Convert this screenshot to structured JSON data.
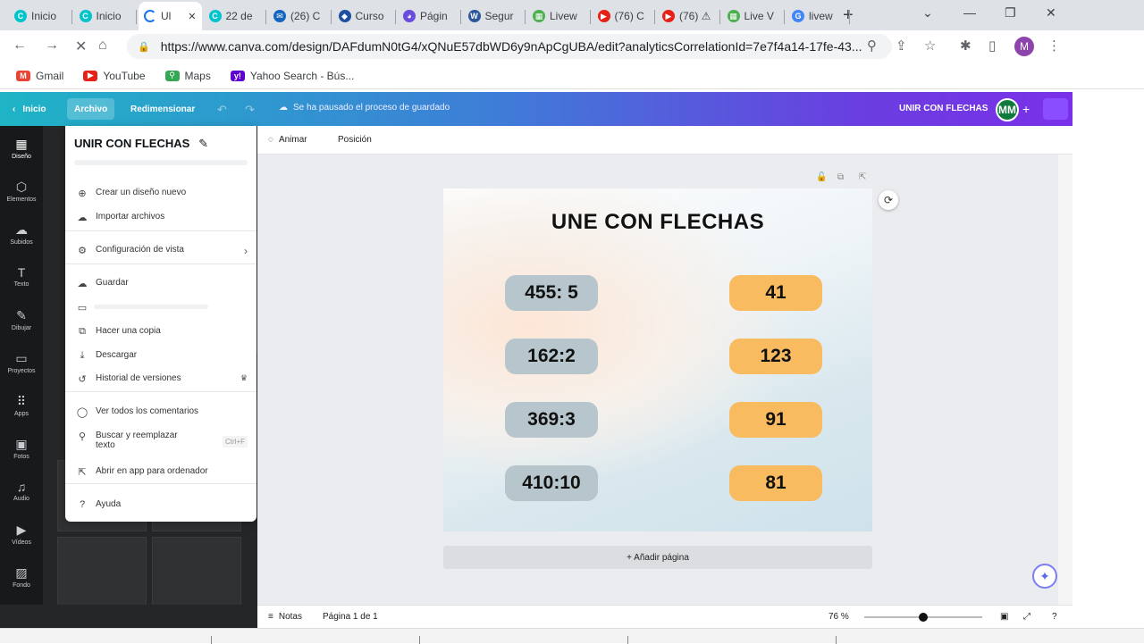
{
  "browser": {
    "tabs": [
      {
        "label": "Inicio",
        "color": "#00c4cc",
        "glyph": "C"
      },
      {
        "label": "Inicio",
        "color": "#00c4cc",
        "glyph": "C"
      },
      {
        "label": "Ul",
        "color": "#1a73e8",
        "glyph": "",
        "active": true
      },
      {
        "label": "22 de",
        "color": "#00c4cc",
        "glyph": "C"
      },
      {
        "label": "(26) C",
        "color": "#1565c0",
        "glyph": "✉"
      },
      {
        "label": "Curso",
        "color": "#1e4fa0",
        "glyph": "◆"
      },
      {
        "label": "Págin",
        "color": "#6a4cdf",
        "glyph": "◕"
      },
      {
        "label": "Segur",
        "color": "#2b579a",
        "glyph": "W"
      },
      {
        "label": "Livew",
        "color": "#4caf50",
        "glyph": "▦"
      },
      {
        "label": "(76) C",
        "color": "#e62117",
        "glyph": "▶"
      },
      {
        "label": "(76) ⚠",
        "color": "#e62117",
        "glyph": "▶"
      },
      {
        "label": "Live V",
        "color": "#4caf50",
        "glyph": "▦"
      },
      {
        "label": "livew",
        "color": "#4285f4",
        "glyph": "G"
      }
    ],
    "url": "https://www.canva.com/design/DAFdumN0tG4/xQNuE57dbWD6y9nApCgUBA/edit?analyticsCorrelationId=7e7f4a14-17fe-43...",
    "profile_initial": "M",
    "bookmarks": [
      {
        "label": "Gmail",
        "color": "#ea4335",
        "glyph": "M"
      },
      {
        "label": "YouTube",
        "color": "#e62117",
        "glyph": "▶"
      },
      {
        "label": "Maps",
        "color": "#34a853",
        "glyph": "⚲"
      },
      {
        "label": "Yahoo Search - Bús...",
        "color": "#5f01d1",
        "glyph": "y!"
      }
    ]
  },
  "canva_header": {
    "home": "Inicio",
    "file": "Archivo",
    "resize": "Redimensionar",
    "status": "Se ha pausado el proceso de guardado",
    "design_title": "UNIR CON FLECHAS",
    "user_initials": "MM"
  },
  "rail": [
    {
      "label": "Diseño",
      "icon": "▦",
      "active": true
    },
    {
      "label": "Elementos",
      "icon": "⬡"
    },
    {
      "label": "Subidos",
      "icon": "☁"
    },
    {
      "label": "Texto",
      "icon": "T"
    },
    {
      "label": "Dibujar",
      "icon": "✎"
    },
    {
      "label": "Proyectos",
      "icon": "▭"
    },
    {
      "label": "Apps",
      "icon": "⠿"
    },
    {
      "label": "Fotos",
      "icon": "▣"
    },
    {
      "label": "Audio",
      "icon": "♫"
    },
    {
      "label": "Vídeos",
      "icon": "▶"
    },
    {
      "label": "Fondo",
      "icon": "▨"
    }
  ],
  "file_menu": {
    "title": "UNIR CON FLECHAS",
    "items": [
      {
        "label": "Crear un diseño nuevo",
        "icon": "⊕"
      },
      {
        "label": "Importar archivos",
        "icon": "☁"
      },
      {
        "label": "Configuración de vista",
        "icon": "⚙",
        "arrow": "›"
      },
      {
        "label": "Guardar",
        "icon": "☁"
      },
      {
        "label": "",
        "icon": "▭"
      },
      {
        "label": "Hacer una copia",
        "icon": "⧉"
      },
      {
        "label": "Descargar",
        "icon": "⤓"
      },
      {
        "label": "Historial de versiones",
        "icon": "↺",
        "badge": "♛"
      },
      {
        "label": "Ver todos los comentarios",
        "icon": "◯"
      },
      {
        "label": "Buscar y reemplazar texto",
        "icon": "⚲",
        "shortcut": "Ctrl+F"
      },
      {
        "label": "Abrir en app para ordenador",
        "icon": "⇱"
      },
      {
        "label": "Ayuda",
        "icon": "?"
      }
    ]
  },
  "toolbar": {
    "animate": "Animar",
    "position": "Posición"
  },
  "design": {
    "title": "UNE CON FLECHAS",
    "left": [
      "455: 5",
      "162:2",
      "369:3",
      "410:10"
    ],
    "right": [
      "41",
      "123",
      "91",
      "81"
    ],
    "left_color": "#b7c6cc",
    "right_color": "#f9bb5f"
  },
  "add_page": "+ Añadir página",
  "footer": {
    "notes": "Notas",
    "page": "Página 1 de 1",
    "zoom": "76 %",
    "zoom_level": 0.5
  }
}
